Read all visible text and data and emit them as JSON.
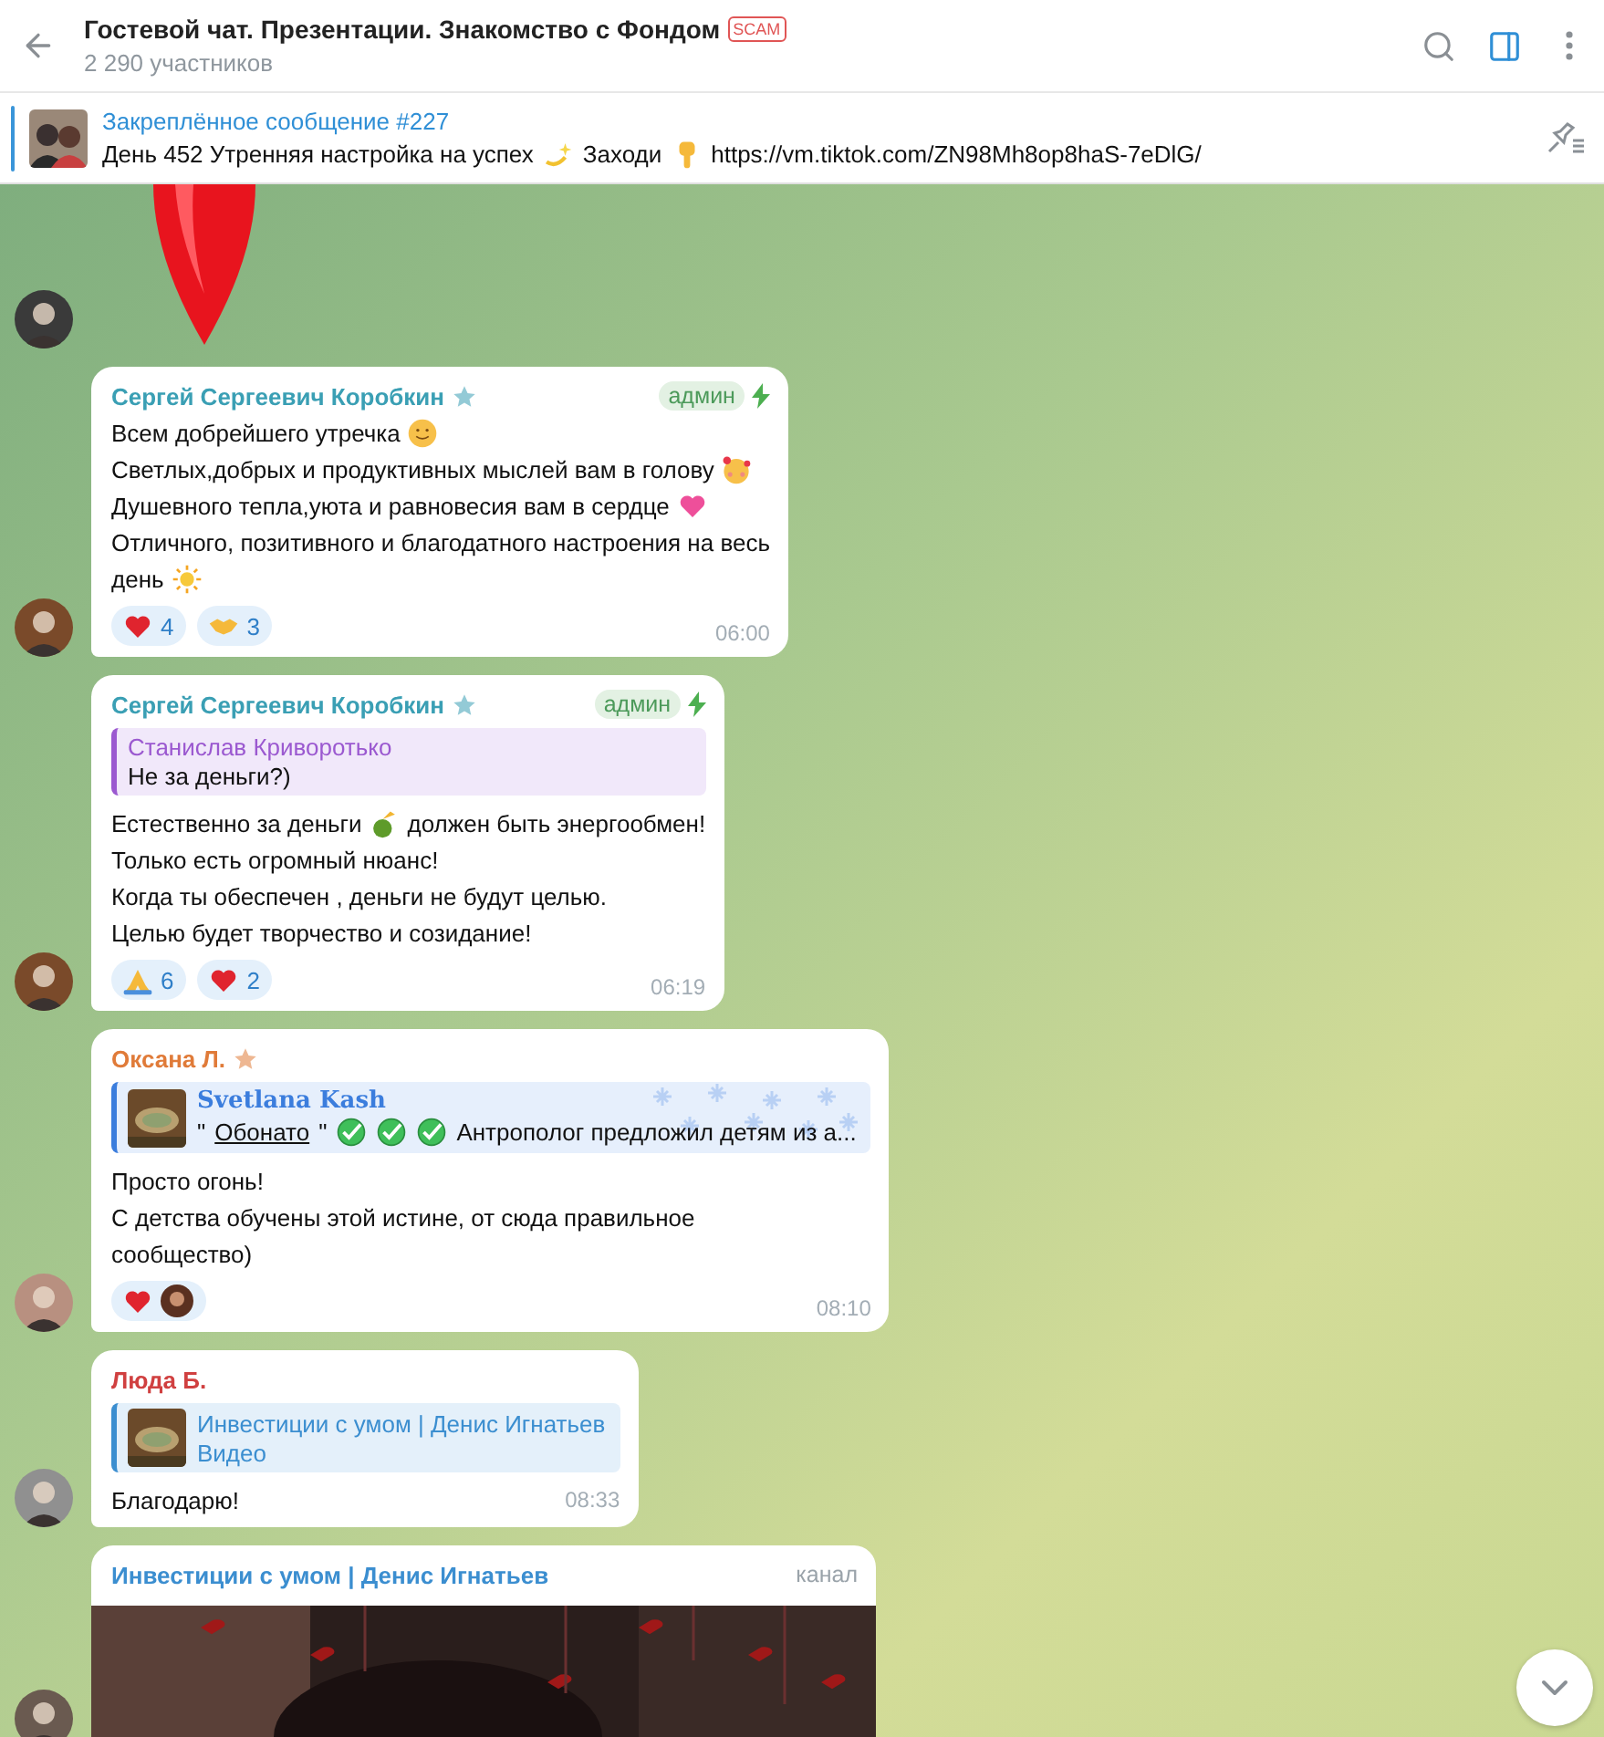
{
  "header": {
    "title": "Гостевой чат. Презентации. Знакомство с Фондом",
    "badge": "SCAM",
    "subtitle": "2 290 участников"
  },
  "pinned": {
    "label": "Закреплённое сообщение #227",
    "parts": [
      {
        "kind": "text",
        "text": "День 452 Утренняя настройка на успех"
      },
      {
        "kind": "sparkle"
      },
      {
        "kind": "text",
        "text": "Заходи"
      },
      {
        "kind": "pointer"
      },
      {
        "kind": "text",
        "text": "https://vm.tiktok.com/ZN98Mh8op8haS-7eDlG/"
      }
    ]
  },
  "messages": [
    {
      "kind": "sticker"
    },
    {
      "kind": "text",
      "sender": {
        "name": "Сергей Сергеевич Коробкин",
        "color": "#3a9fb4",
        "starred": true
      },
      "badge": "админ",
      "boost": true,
      "lines": [
        [
          {
            "kind": "text",
            "text": "Всем добрейшего утречка"
          },
          {
            "kind": "smiley"
          }
        ],
        [
          {
            "kind": "text",
            "text": "Светлых,добрых и продуктивных мыслей вам в голову"
          },
          {
            "kind": "hearteyes"
          }
        ],
        [
          {
            "kind": "text",
            "text": "Душевного тепла,уюта и равновесия вам в сердце"
          },
          {
            "kind": "pinkheart"
          }
        ],
        [
          {
            "kind": "text",
            "text": "Отличного, позитивного и благодатного настроения на весь"
          }
        ],
        [
          {
            "kind": "text",
            "text": "день"
          },
          {
            "kind": "sun"
          }
        ]
      ],
      "reactions": [
        {
          "kind": "heart",
          "count": "4"
        },
        {
          "kind": "handshake",
          "count": "3"
        }
      ],
      "time": "06:00"
    },
    {
      "kind": "text",
      "sender": {
        "name": "Сергей Сергеевич Коробкин",
        "color": "#3a9fb4",
        "starred": true
      },
      "badge": "админ",
      "boost": true,
      "reply": {
        "kind": "quote",
        "name": "Станислав Криворотько",
        "color": "#9b59d0",
        "parts": [
          {
            "kind": "text",
            "text": "Не за деньги?)"
          }
        ]
      },
      "lines": [
        [
          {
            "kind": "text",
            "text": "Естественно за деньги"
          },
          {
            "kind": "moneybag"
          },
          {
            "kind": "text",
            "text": "должен быть энергообмен!"
          }
        ],
        [
          {
            "kind": "text",
            "text": "Только есть огромный нюанс!"
          }
        ],
        [
          {
            "kind": "text",
            "text": "Когда ты обеспечен , деньги не будут целью."
          }
        ],
        [
          {
            "kind": "text",
            "text": "Целью будет творчество и созидание!"
          }
        ]
      ],
      "reactions": [
        {
          "kind": "pray",
          "count": "6"
        },
        {
          "kind": "heart",
          "count": "2"
        }
      ],
      "time": "06:19"
    },
    {
      "kind": "text",
      "sender": {
        "name": "Оксана Л.",
        "color": "#e07b39",
        "starred": true
      },
      "reply": {
        "kind": "fancy",
        "name": "Svetlana Kash",
        "color": "#3b7ddd",
        "thumb": true,
        "parts": [
          {
            "kind": "text",
            "text": "\""
          },
          {
            "kind": "text",
            "text": "Обонато",
            "underline": true
          },
          {
            "kind": "text",
            "text": "\""
          },
          {
            "kind": "check"
          },
          {
            "kind": "check"
          },
          {
            "kind": "check"
          },
          {
            "kind": "text",
            "text": "Антрополог предложил детям из а..."
          }
        ]
      },
      "lines": [
        [
          {
            "kind": "text",
            "text": "Просто огонь!"
          }
        ],
        [
          {
            "kind": "text",
            "text": "С детства обучены этой истине, от сюда правильное"
          }
        ],
        [
          {
            "kind": "text",
            "text": "сообщество)"
          }
        ]
      ],
      "reactions": [
        {
          "kind": "heart",
          "avatar": true
        }
      ],
      "time": "08:10"
    },
    {
      "kind": "text",
      "sender": {
        "name": "Люда Б.",
        "color": "#d04040"
      },
      "reply": {
        "kind": "media",
        "name": "Инвестиции с умом | Денис Игнатьев",
        "color": "#3b8ed0",
        "thumb": true,
        "parts": [
          {
            "kind": "text",
            "text": "Видео"
          }
        ]
      },
      "lines": [
        [
          {
            "kind": "text",
            "text": "Благодарю!"
          }
        ]
      ],
      "time": "08:33"
    },
    {
      "kind": "channel",
      "sender": {
        "name": "Инвестиции с умом | Денис Игнатьев",
        "color": "#3b8ed0"
      },
      "badge": "канал"
    }
  ]
}
